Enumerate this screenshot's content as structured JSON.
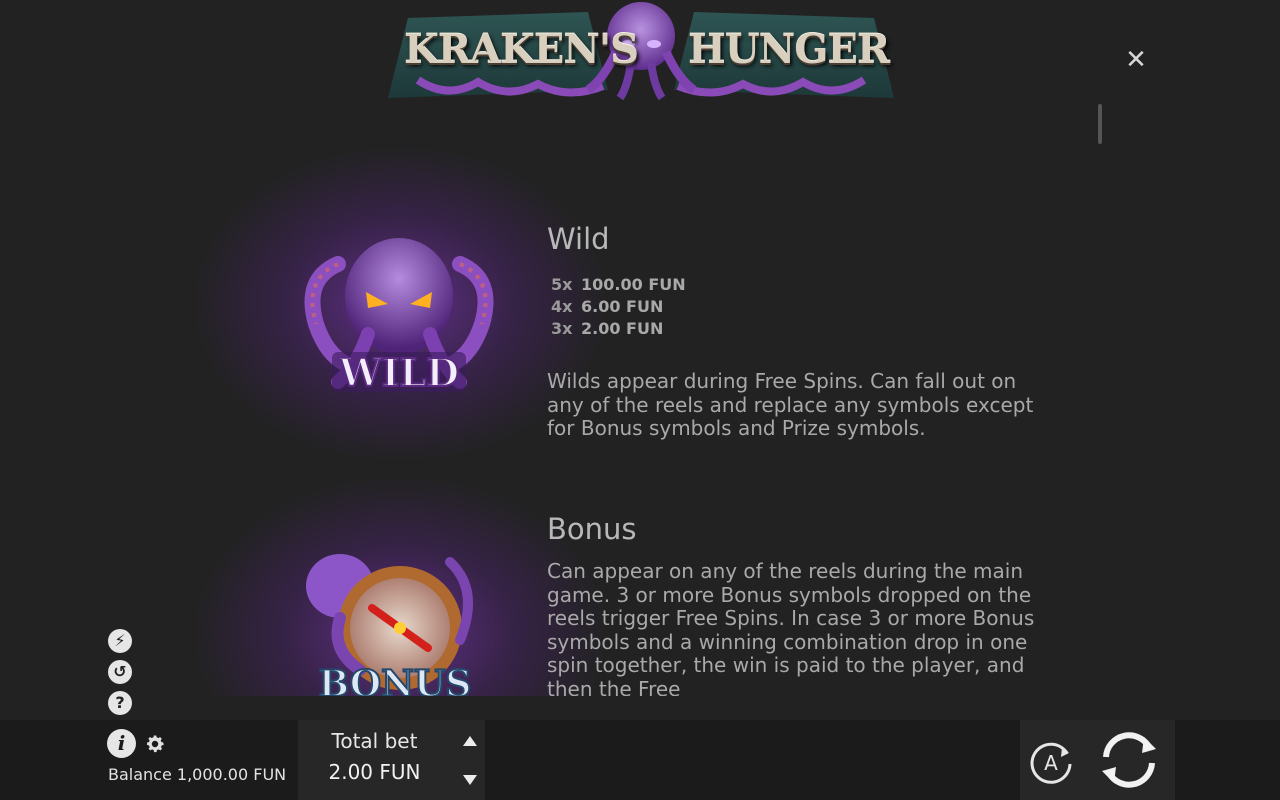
{
  "header": {
    "logo_left": "KRAKEN'S",
    "logo_right": "HUNGER",
    "close_icon": "close-icon"
  },
  "symbols": [
    {
      "art_label": "WILD",
      "title": "Wild",
      "payouts": [
        {
          "mult": "5x",
          "amount": "100.00 FUN"
        },
        {
          "mult": "4x",
          "amount": "6.00 FUN"
        },
        {
          "mult": "3x",
          "amount": "2.00 FUN"
        }
      ],
      "description": "Wilds appear during Free Spins. Can fall out on any of the reels and replace any symbols except for Bonus symbols and Prize symbols."
    },
    {
      "art_label": "BONUS",
      "title": "Bonus",
      "description": "Can appear on any of the reels during the main game. 3 or more Bonus symbols dropped on the reels trigger Free Spins. In case 3 or more Bonus symbols and a winning combination drop in one spin together, the win is paid to the player, and then the Free"
    }
  ],
  "side_icons": [
    {
      "icon": "turbo-icon",
      "glyph": "⚡"
    },
    {
      "icon": "history-icon",
      "glyph": "↺"
    },
    {
      "icon": "help-icon",
      "glyph": "?"
    }
  ],
  "footer": {
    "info_glyph": "i",
    "balance_label": "Balance",
    "balance_value": "1,000.00 FUN",
    "total_bet_label": "Total bet",
    "total_bet_value": "2.00 FUN",
    "autoplay_glyph": "A"
  },
  "colors": {
    "background": "#222222",
    "bar": "#1b1b1b",
    "accent_purple": "#7a3cb4"
  }
}
